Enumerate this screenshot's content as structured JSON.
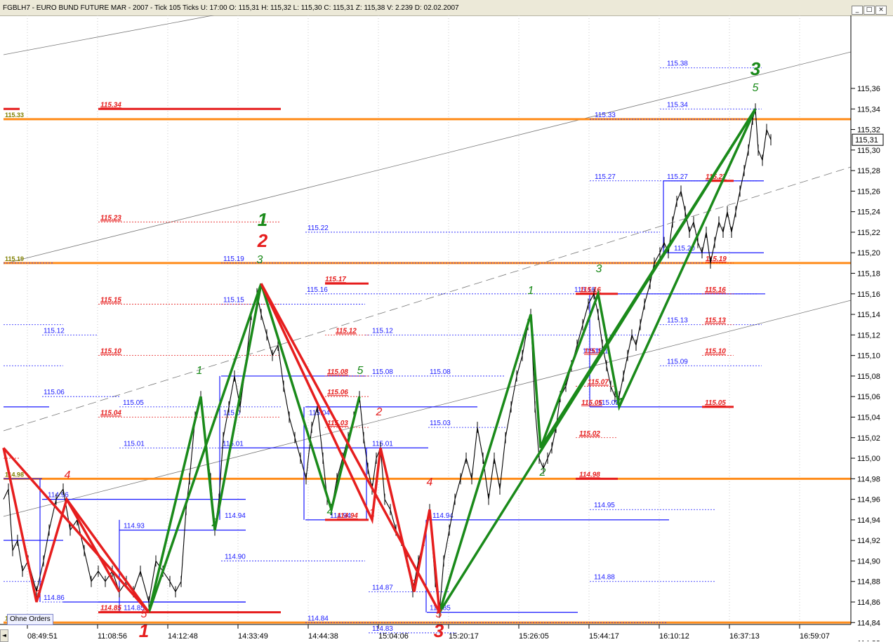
{
  "window": {
    "title": "FGBLH7 - EURO BUND FUTURE  MAR - 2007 - Tick 105 Ticks  U: 17:00  O: 115,31  H: 115,32  L: 115,30  C: 115,31  Z: 115,38  V: 2.239  D: 02.02.2007",
    "buttons": [
      "_",
      "□",
      "×"
    ]
  },
  "controls": {
    "orders_button": "Ohne Orders",
    "scroll_left": "◄"
  },
  "chart_data": {
    "type": "line",
    "title": "FGBLH7 - EURO BUND FUTURE  MAR - 2007",
    "ylim": [
      114.805,
      115.395
    ],
    "y_ticks": [
      "114,82",
      "114,84",
      "114,86",
      "114,88",
      "114,90",
      "114,92",
      "114,94",
      "114,96",
      "114,98",
      "115,00",
      "115,02",
      "115,04",
      "115,06",
      "115,08",
      "115,10",
      "115,12",
      "115,14",
      "115,16",
      "115,18",
      "115,20",
      "115,22",
      "115,24",
      "115,26",
      "115,28",
      "115,30",
      "115,32",
      "115,34",
      "115,36"
    ],
    "x_ticks": [
      "08:49:51",
      "11:08:56",
      "14:12:48",
      "14:33:49",
      "14:44:38",
      "15:04:06",
      "15:20:17",
      "15:26:05",
      "15:44:17",
      "16:10:12",
      "16:37:13",
      "16:59:07"
    ],
    "last_price": "115,31",
    "price_series": [
      [
        5,
        114.96
      ],
      [
        12,
        114.97
      ],
      [
        18,
        114.91
      ],
      [
        25,
        114.92
      ],
      [
        32,
        114.89
      ],
      [
        40,
        114.9
      ],
      [
        52,
        114.87
      ],
      [
        62,
        114.9
      ],
      [
        70,
        114.93
      ],
      [
        80,
        114.96
      ],
      [
        90,
        114.97
      ],
      [
        100,
        114.93
      ],
      [
        110,
        114.94
      ],
      [
        120,
        114.91
      ],
      [
        130,
        114.88
      ],
      [
        140,
        114.89
      ],
      [
        150,
        114.88
      ],
      [
        160,
        114.89
      ],
      [
        170,
        114.87
      ],
      [
        180,
        114.88
      ],
      [
        190,
        114.87
      ],
      [
        200,
        114.89
      ],
      [
        212,
        114.86
      ],
      [
        222,
        114.9
      ],
      [
        232,
        114.89
      ],
      [
        242,
        114.88
      ],
      [
        250,
        114.87
      ],
      [
        258,
        114.88
      ],
      [
        265,
        114.95
      ],
      [
        270,
        114.98
      ],
      [
        278,
        115.04
      ],
      [
        286,
        115.06
      ],
      [
        292,
        115.02
      ],
      [
        300,
        114.98
      ],
      [
        306,
        114.93
      ],
      [
        312,
        114.96
      ],
      [
        318,
        115.02
      ],
      [
        326,
        115.05
      ],
      [
        334,
        115.08
      ],
      [
        342,
        115.05
      ],
      [
        350,
        115.09
      ],
      [
        358,
        115.14
      ],
      [
        366,
        115.16
      ],
      [
        372,
        115.14
      ],
      [
        380,
        115.12
      ],
      [
        388,
        115.1
      ],
      [
        396,
        115.11
      ],
      [
        404,
        115.07
      ],
      [
        412,
        115.04
      ],
      [
        420,
        115.02
      ],
      [
        428,
        115.0
      ],
      [
        436,
        114.98
      ],
      [
        444,
        115.03
      ],
      [
        452,
        115.05
      ],
      [
        460,
        115.0
      ],
      [
        466,
        114.96
      ],
      [
        472,
        114.95
      ],
      [
        480,
        114.98
      ],
      [
        488,
        115.0
      ],
      [
        496,
        115.02
      ],
      [
        504,
        115.04
      ],
      [
        512,
        115.06
      ],
      [
        518,
        115.02
      ],
      [
        524,
        114.99
      ],
      [
        530,
        114.97
      ],
      [
        536,
        115.0
      ],
      [
        542,
        115.01
      ],
      [
        548,
        114.96
      ],
      [
        556,
        114.95
      ],
      [
        564,
        114.93
      ],
      [
        572,
        114.92
      ],
      [
        580,
        114.9
      ],
      [
        588,
        114.87
      ],
      [
        596,
        114.9
      ],
      [
        604,
        114.92
      ],
      [
        612,
        114.95
      ],
      [
        620,
        114.88
      ],
      [
        626,
        114.85
      ],
      [
        632,
        114.9
      ],
      [
        640,
        114.93
      ],
      [
        648,
        114.96
      ],
      [
        656,
        114.98
      ],
      [
        664,
        115.0
      ],
      [
        672,
        114.98
      ],
      [
        680,
        115.03
      ],
      [
        688,
        115.0
      ],
      [
        696,
        114.96
      ],
      [
        704,
        115.0
      ],
      [
        712,
        114.97
      ],
      [
        720,
        115.02
      ],
      [
        728,
        115.05
      ],
      [
        736,
        115.08
      ],
      [
        744,
        115.1
      ],
      [
        752,
        115.13
      ],
      [
        756,
        115.14
      ],
      [
        762,
        115.05
      ],
      [
        768,
        115.0
      ],
      [
        774,
        114.99
      ],
      [
        780,
        115.0
      ],
      [
        786,
        115.01
      ],
      [
        792,
        115.03
      ],
      [
        798,
        115.06
      ],
      [
        806,
        115.07
      ],
      [
        814,
        115.09
      ],
      [
        822,
        115.11
      ],
      [
        830,
        115.13
      ],
      [
        838,
        115.15
      ],
      [
        846,
        115.16
      ],
      [
        852,
        115.14
      ],
      [
        858,
        115.11
      ],
      [
        864,
        115.09
      ],
      [
        870,
        115.07
      ],
      [
        876,
        115.06
      ],
      [
        882,
        115.06
      ],
      [
        888,
        115.08
      ],
      [
        894,
        115.1
      ],
      [
        900,
        115.12
      ],
      [
        906,
        115.11
      ],
      [
        912,
        115.13
      ],
      [
        918,
        115.15
      ],
      [
        926,
        115.17
      ],
      [
        932,
        115.19
      ],
      [
        940,
        115.2
      ],
      [
        946,
        115.21
      ],
      [
        952,
        115.2
      ],
      [
        958,
        115.23
      ],
      [
        964,
        115.25
      ],
      [
        970,
        115.26
      ],
      [
        976,
        115.24
      ],
      [
        982,
        115.22
      ],
      [
        988,
        115.23
      ],
      [
        994,
        115.21
      ],
      [
        1000,
        115.2
      ],
      [
        1006,
        115.22
      ],
      [
        1012,
        115.19
      ],
      [
        1018,
        115.21
      ],
      [
        1024,
        115.23
      ],
      [
        1030,
        115.22
      ],
      [
        1036,
        115.24
      ],
      [
        1042,
        115.22
      ],
      [
        1048,
        115.24
      ],
      [
        1054,
        115.26
      ],
      [
        1060,
        115.28
      ],
      [
        1066,
        115.3
      ],
      [
        1072,
        115.33
      ],
      [
        1076,
        115.34
      ],
      [
        1080,
        115.3
      ],
      [
        1086,
        115.29
      ],
      [
        1092,
        115.32
      ],
      [
        1098,
        115.31
      ]
    ],
    "horizontal_levels": [
      {
        "value": 115.33,
        "label": "115.33",
        "color": "#808000"
      },
      {
        "value": 115.19,
        "label": "115.19",
        "color": "#808000"
      },
      {
        "value": 114.98,
        "label": "114.98",
        "color": "#808000"
      },
      {
        "value": 114.84,
        "label": "114.84",
        "color": "#808000"
      }
    ],
    "red_levels": [
      {
        "label": "115.34",
        "value": 115.34
      },
      {
        "label": "115.23",
        "value": 115.23
      },
      {
        "label": "115.17",
        "value": 115.17
      },
      {
        "label": "115.15",
        "value": 115.15
      },
      {
        "label": "115.12",
        "value": 115.12
      },
      {
        "label": "115.10",
        "value": 115.1
      },
      {
        "label": "115.08",
        "value": 115.08
      },
      {
        "label": "115.06",
        "value": 115.06
      },
      {
        "label": "115.04",
        "value": 115.04
      },
      {
        "label": "115.03",
        "value": 115.03
      },
      {
        "label": "114.94",
        "value": 114.94
      },
      {
        "label": "114.85",
        "value": 114.85
      },
      {
        "label": "115.27",
        "value": 115.27
      },
      {
        "label": "115.19",
        "value": 115.19
      },
      {
        "label": "115.16",
        "value": 115.16
      },
      {
        "label": "115.13",
        "value": 115.13
      },
      {
        "label": "115.10",
        "value": 115.1
      },
      {
        "label": "115.07",
        "value": 115.07
      },
      {
        "label": "115.05",
        "value": 115.05
      },
      {
        "label": "115.02",
        "value": 115.02
      },
      {
        "label": "114.98",
        "value": 114.98
      },
      {
        "label": "115.1",
        "value": 115.1
      },
      {
        "label": "115.16",
        "value": 115.16
      },
      {
        "label": "115.05",
        "value": 115.05
      }
    ],
    "blue_levels": [
      {
        "label": "115.38",
        "value": 115.38
      },
      {
        "label": "115.34",
        "value": 115.34
      },
      {
        "label": "115.33",
        "value": 115.33
      },
      {
        "label": "115.27",
        "value": 115.27
      },
      {
        "label": "115.27",
        "value": 115.27
      },
      {
        "label": "115.22",
        "value": 115.22
      },
      {
        "label": "115.20",
        "value": 115.2
      },
      {
        "label": "115.19",
        "value": 115.19
      },
      {
        "label": "115.16",
        "value": 115.16
      },
      {
        "label": "115.15",
        "value": 115.15
      },
      {
        "label": "115.16",
        "value": 115.16
      },
      {
        "label": "115.13",
        "value": 115.13
      },
      {
        "label": "115.12",
        "value": 115.12
      },
      {
        "label": "115.12",
        "value": 115.12
      },
      {
        "label": "115.09",
        "value": 115.09
      },
      {
        "label": "115.08",
        "value": 115.08
      },
      {
        "label": "115.08",
        "value": 115.08
      },
      {
        "label": "115.06",
        "value": 115.06
      },
      {
        "label": "115.05",
        "value": 115.05
      },
      {
        "label": "115.05",
        "value": 115.05
      },
      {
        "label": "115.04",
        "value": 115.04
      },
      {
        "label": "115.01",
        "value": 115.01
      },
      {
        "label": "115.01",
        "value": 115.01
      },
      {
        "label": "115.01",
        "value": 115.01
      },
      {
        "label": "115.03",
        "value": 115.03
      },
      {
        "label": "114.96",
        "value": 114.96
      },
      {
        "label": "114.95",
        "value": 114.95
      },
      {
        "label": "114.94",
        "value": 114.94
      },
      {
        "label": "114.94",
        "value": 114.94
      },
      {
        "label": "114.94",
        "value": 114.94
      },
      {
        "label": "114.93",
        "value": 114.93
      },
      {
        "label": "114.90",
        "value": 114.9
      },
      {
        "label": "114.88",
        "value": 114.88
      },
      {
        "label": "114.87",
        "value": 114.87
      },
      {
        "label": "114.86",
        "value": 114.86
      },
      {
        "label": "114.85",
        "value": 114.85
      },
      {
        "label": "114.85",
        "value": 114.85
      },
      {
        "label": "114.84",
        "value": 114.84
      },
      {
        "label": "114.83",
        "value": 114.83
      },
      {
        "label": "115.1",
        "value": 115.1
      },
      {
        "label": "115.1",
        "value": 115.1
      },
      {
        "label": "115.0",
        "value": 115.04
      }
    ],
    "wave_labels": [
      {
        "text": "1",
        "color": "green",
        "kind": "big"
      },
      {
        "text": "2",
        "color": "red",
        "kind": "big"
      },
      {
        "text": "3",
        "color": "green",
        "kind": "small"
      },
      {
        "text": "1",
        "color": "green",
        "kind": "small"
      },
      {
        "text": "2",
        "color": "green",
        "kind": "small"
      },
      {
        "text": "3",
        "color": "green",
        "kind": "small"
      },
      {
        "text": "4",
        "color": "green",
        "kind": "small"
      },
      {
        "text": "5",
        "color": "green",
        "kind": "small"
      },
      {
        "text": "1",
        "color": "green",
        "kind": "small"
      },
      {
        "text": "2",
        "color": "green",
        "kind": "small"
      },
      {
        "text": "3",
        "color": "green",
        "kind": "small"
      },
      {
        "text": "4",
        "color": "green",
        "kind": "small"
      },
      {
        "text": "5",
        "color": "green",
        "kind": "small"
      },
      {
        "text": "3",
        "color": "green",
        "kind": "big"
      },
      {
        "text": "4",
        "color": "red",
        "kind": "small"
      },
      {
        "text": "3",
        "color": "red",
        "kind": "small"
      },
      {
        "text": "5",
        "color": "red",
        "kind": "small"
      },
      {
        "text": "1",
        "color": "red",
        "kind": "big"
      },
      {
        "text": "1",
        "color": "red",
        "kind": "small"
      },
      {
        "text": "2",
        "color": "red",
        "kind": "small"
      },
      {
        "text": "3",
        "color": "red",
        "kind": "small"
      },
      {
        "text": "4",
        "color": "red",
        "kind": "small"
      },
      {
        "text": "5",
        "color": "red",
        "kind": "small"
      },
      {
        "text": "3",
        "color": "red",
        "kind": "big"
      }
    ],
    "colors": {
      "up_wave": "#1a8a1a",
      "down_wave": "#e61e1e",
      "level": "#ff8c1a",
      "blue": "#1a1aff",
      "red_level": "#e61e1e",
      "price": "#000000",
      "grid": "#c8c8c8"
    }
  }
}
